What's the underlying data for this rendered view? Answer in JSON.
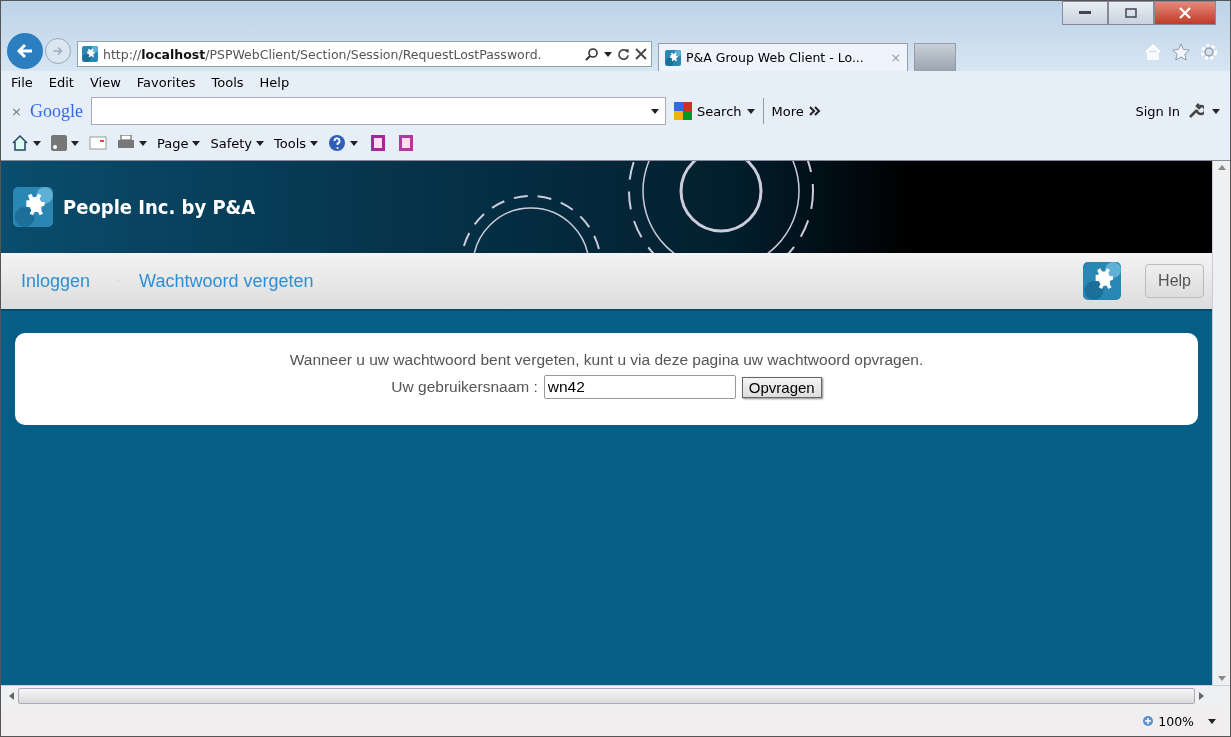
{
  "browser": {
    "address": "http://**localhost**/PSPWebClient/Section/Session/RequestLostPassword.",
    "tabs": [
      {
        "label": "P&A Group Web Client - Lo...",
        "close": "×",
        "selected": true
      },
      {
        "selected": false
      }
    ],
    "menu": [
      "File",
      "Edit",
      "View",
      "Favorites",
      "Tools",
      "Help"
    ],
    "google": {
      "close": "×",
      "logo": "Google",
      "search": "Search",
      "more": "More",
      "sign_in": "Sign In"
    },
    "commands": [
      "Page",
      "Safety",
      "Tools"
    ],
    "zoom": "100%"
  },
  "page": {
    "brand": "People Inc. by P&A",
    "breadcrumbs": [
      "Inloggen",
      "Wachtwoord vergeten"
    ],
    "help": "Help",
    "message": "Wanneer u uw wachtwoord bent vergeten, kunt u via deze pagina uw wachtwoord opvragen.",
    "username_label": "Uw gebruikersnaam :",
    "username_value": "wn42",
    "submit": "Opvragen"
  }
}
